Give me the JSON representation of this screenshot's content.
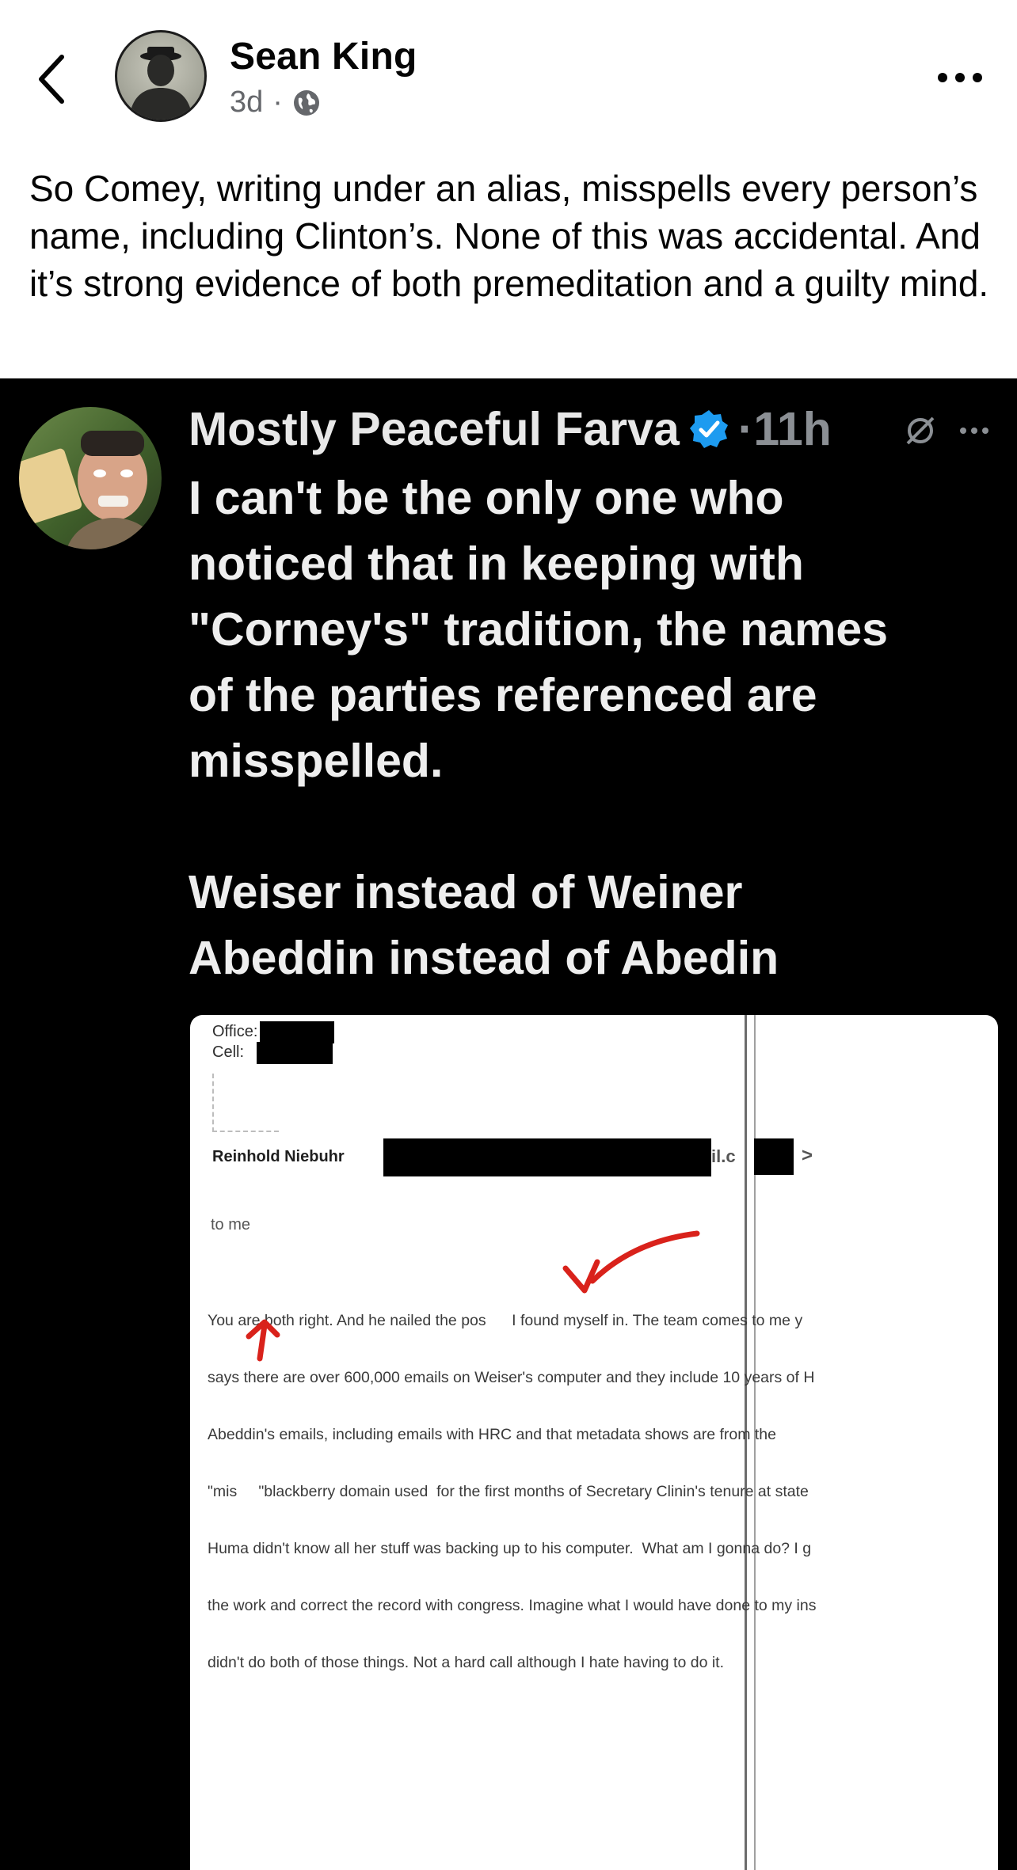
{
  "post": {
    "author": "Sean King",
    "time": "3d",
    "separator": "·",
    "audience_icon": "globe-icon",
    "caption": "So Comey, writing under an alias, misspells every person’s name, including Clinton’s.   None of this was accidental.  And it’s strong evidence of both premeditation and a guilty mind."
  },
  "tweet": {
    "name": "Mostly Peaceful Farva",
    "verified": true,
    "time": "·11h",
    "body": "I can't be the only one who\nnoticed that in keeping with\n\"Corney's\" tradition, the names\nof the parties referenced are\nmisspelled.\n\nWeiser instead of Weiner\nAbeddin instead of Abedin"
  },
  "document": {
    "office_label": "Office:",
    "cell_label": "Cell:",
    "sender": "Reinhold Niebuhr",
    "email_fragment": "il.c",
    "email_end": ">",
    "to": "to me",
    "lines": [
      "You are both right. And he nailed the pos      I found myself in. The team comes to me y",
      "says there are over 600,000 emails on Weiser's computer and they include 10 years of H",
      "Abeddin's emails, including emails with HRC and that metadata shows are from the",
      "\"mis     \"blackberry domain used  for the first months of Secretary Clinin's tenure at state",
      "Huma didn't know all her stuff was backing up to his computer.  What am I gonna do? I g",
      "the work and correct the record with congress. Imagine what I would have done to my ins",
      "didn't do both of those things. Not a hard call although I hate having to do it."
    ]
  },
  "colors": {
    "accent_verified": "#1d9bf0",
    "annotation_red": "#d9221b",
    "meta_gray": "#65676b"
  }
}
